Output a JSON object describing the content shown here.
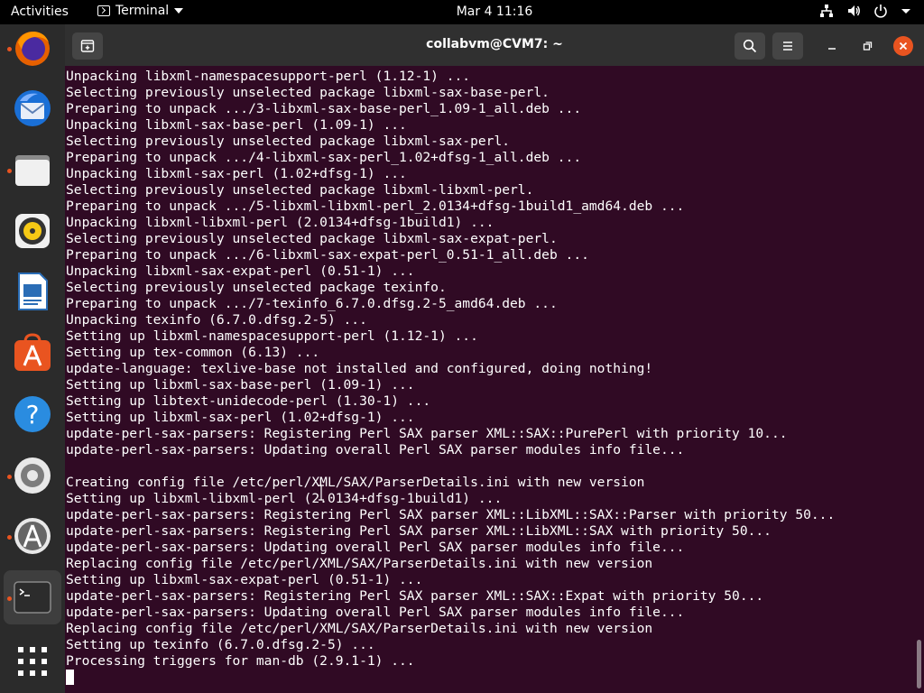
{
  "topbar": {
    "activities": "Activities",
    "app_menu": "Terminal",
    "clock": "Mar 4  11:16",
    "tray_icons": [
      "network-icon",
      "volume-icon",
      "power-icon",
      "chevron-down-icon"
    ]
  },
  "dock": {
    "items": [
      {
        "name": "firefox",
        "icon": "firefox-icon",
        "running": true
      },
      {
        "name": "thunderbird",
        "icon": "thunderbird-icon",
        "running": false
      },
      {
        "name": "files",
        "icon": "files-icon",
        "running": true
      },
      {
        "name": "rhythmbox",
        "icon": "rhythmbox-icon",
        "running": false
      },
      {
        "name": "libreoffice-writer",
        "icon": "writer-icon",
        "running": false
      },
      {
        "name": "ubuntu-software",
        "icon": "software-icon",
        "running": false
      },
      {
        "name": "help",
        "icon": "help-icon",
        "running": false
      },
      {
        "name": "settings",
        "icon": "settings-icon",
        "running": true
      },
      {
        "name": "software-updater",
        "icon": "updater-icon",
        "running": true
      },
      {
        "name": "terminal",
        "icon": "terminal-icon",
        "running": true
      },
      {
        "name": "show-applications",
        "icon": "app-grid-icon",
        "running": false
      }
    ]
  },
  "window": {
    "title": "collabvm@CVM7: ~"
  },
  "colors": {
    "terminal_bg": "#300a24",
    "accent": "#e95420",
    "close_button": "#e95420"
  },
  "terminal": {
    "lines": [
      "Unpacking libxml-namespacesupport-perl (1.12-1) ...",
      "Selecting previously unselected package libxml-sax-base-perl.",
      "Preparing to unpack .../3-libxml-sax-base-perl_1.09-1_all.deb ...",
      "Unpacking libxml-sax-base-perl (1.09-1) ...",
      "Selecting previously unselected package libxml-sax-perl.",
      "Preparing to unpack .../4-libxml-sax-perl_1.02+dfsg-1_all.deb ...",
      "Unpacking libxml-sax-perl (1.02+dfsg-1) ...",
      "Selecting previously unselected package libxml-libxml-perl.",
      "Preparing to unpack .../5-libxml-libxml-perl_2.0134+dfsg-1build1_amd64.deb ...",
      "Unpacking libxml-libxml-perl (2.0134+dfsg-1build1) ...",
      "Selecting previously unselected package libxml-sax-expat-perl.",
      "Preparing to unpack .../6-libxml-sax-expat-perl_0.51-1_all.deb ...",
      "Unpacking libxml-sax-expat-perl (0.51-1) ...",
      "Selecting previously unselected package texinfo.",
      "Preparing to unpack .../7-texinfo_6.7.0.dfsg.2-5_amd64.deb ...",
      "Unpacking texinfo (6.7.0.dfsg.2-5) ...",
      "Setting up libxml-namespacesupport-perl (1.12-1) ...",
      "Setting up tex-common (6.13) ...",
      "update-language: texlive-base not installed and configured, doing nothing!",
      "Setting up libxml-sax-base-perl (1.09-1) ...",
      "Setting up libtext-unidecode-perl (1.30-1) ...",
      "Setting up libxml-sax-perl (1.02+dfsg-1) ...",
      "update-perl-sax-parsers: Registering Perl SAX parser XML::SAX::PurePerl with priority 10...",
      "update-perl-sax-parsers: Updating overall Perl SAX parser modules info file...",
      "",
      "Creating config file /etc/perl/XML/SAX/ParserDetails.ini with new version",
      "Setting up libxml-libxml-perl (2.0134+dfsg-1build1) ...",
      "update-perl-sax-parsers: Registering Perl SAX parser XML::LibXML::SAX::Parser with priority 50...",
      "update-perl-sax-parsers: Registering Perl SAX parser XML::LibXML::SAX with priority 50...",
      "update-perl-sax-parsers: Updating overall Perl SAX parser modules info file...",
      "Replacing config file /etc/perl/XML/SAX/ParserDetails.ini with new version",
      "Setting up libxml-sax-expat-perl (0.51-1) ...",
      "update-perl-sax-parsers: Registering Perl SAX parser XML::SAX::Expat with priority 50...",
      "update-perl-sax-parsers: Updating overall Perl SAX parser modules info file...",
      "Replacing config file /etc/perl/XML/SAX/ParserDetails.ini with new version",
      "Setting up texinfo (6.7.0.dfsg.2-5) ...",
      "Processing triggers for man-db (2.9.1-1) ..."
    ]
  }
}
